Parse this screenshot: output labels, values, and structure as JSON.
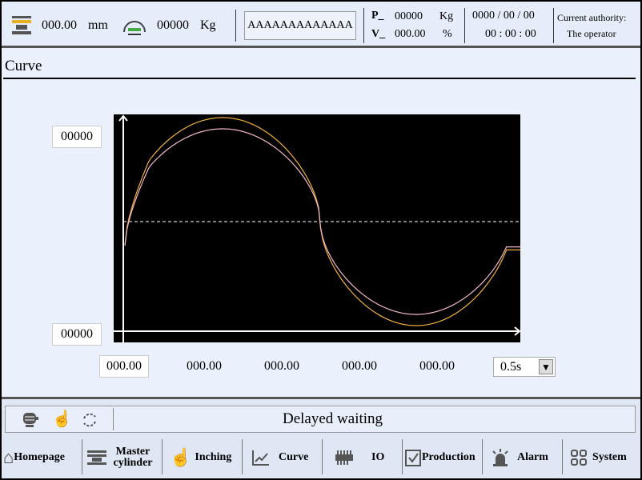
{
  "header": {
    "position_value": "000.00",
    "position_unit": "mm",
    "pressure_value": "00000",
    "pressure_unit": "Kg",
    "name_button": "AAAAAAAAAAAAA",
    "p_label": "P_",
    "p_value": "00000",
    "p_unit": "Kg",
    "v_label": "V_",
    "v_value": "000.00",
    "v_unit": "%",
    "date": "0000 / 00 / 00",
    "time": "00 : 00 : 00",
    "authority_label": "Current authority:",
    "authority_value": "The operator"
  },
  "page": {
    "title": "Curve"
  },
  "chart": {
    "y_max": "00000",
    "y_min": "00000",
    "x_labels": [
      "000.00",
      "000.00",
      "000.00",
      "000.00",
      "000.00"
    ],
    "interval": "0.5s",
    "colors": {
      "background": "#000000",
      "axis": "#ffffff",
      "curve_1": "#f0b040",
      "curve_2": "#f4b8c8",
      "reference": "#ffffff"
    }
  },
  "status": {
    "message": "Delayed waiting"
  },
  "nav": [
    {
      "label": "Homepage",
      "icon": "home-icon"
    },
    {
      "label": "Master cylinder",
      "icon": "press-icon"
    },
    {
      "label": "Inching",
      "icon": "hand-icon"
    },
    {
      "label": "Curve",
      "icon": "chart-icon"
    },
    {
      "label": "IO",
      "icon": "chip-icon"
    },
    {
      "label": "Production",
      "icon": "clipboard-icon"
    },
    {
      "label": "Alarm",
      "icon": "alarm-light-icon"
    },
    {
      "label": "System",
      "icon": "grid-icon"
    }
  ]
}
